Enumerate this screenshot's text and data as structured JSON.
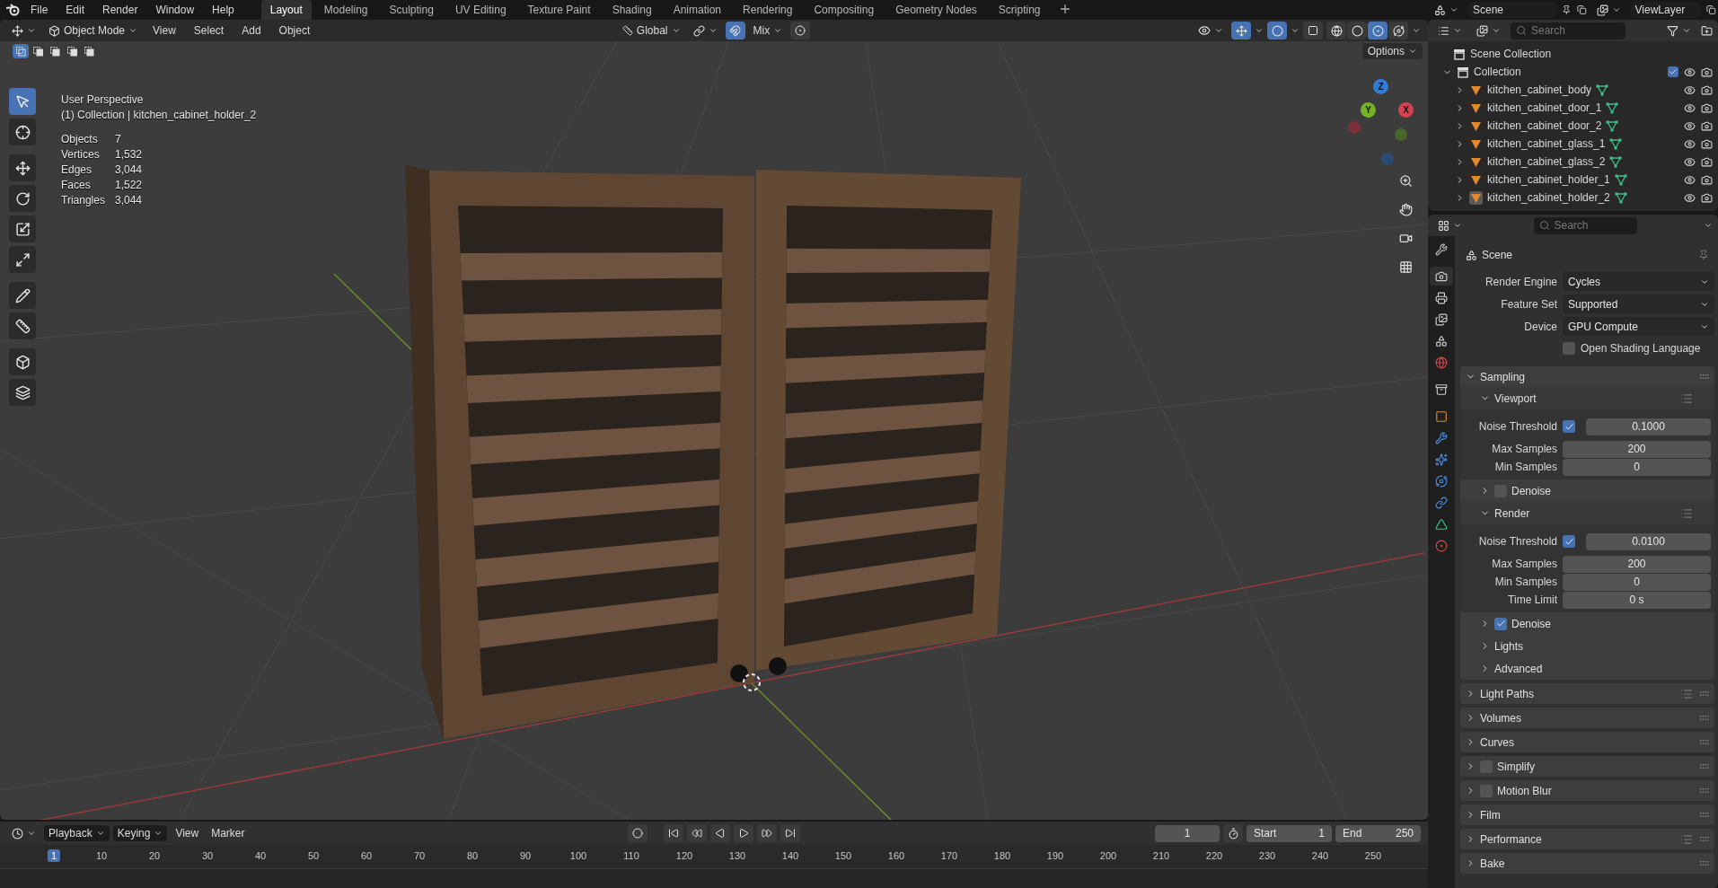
{
  "menu_bar": {
    "menus": [
      "File",
      "Edit",
      "Render",
      "Window",
      "Help"
    ]
  },
  "workspace_tabs": [
    {
      "label": "Layout",
      "selected": true
    },
    {
      "label": "Modeling",
      "selected": false
    },
    {
      "label": "Sculpting",
      "selected": false
    },
    {
      "label": "UV Editing",
      "selected": false
    },
    {
      "label": "Texture Paint",
      "selected": false
    },
    {
      "label": "Shading",
      "selected": false
    },
    {
      "label": "Animation",
      "selected": false
    },
    {
      "label": "Rendering",
      "selected": false
    },
    {
      "label": "Compositing",
      "selected": false
    },
    {
      "label": "Geometry Nodes",
      "selected": false
    },
    {
      "label": "Scripting",
      "selected": false
    }
  ],
  "scene": {
    "value": "Scene"
  },
  "view_layer": {
    "value": "ViewLayer"
  },
  "viewport": {
    "mode": "Object Mode",
    "menus": [
      "View",
      "Select",
      "Add",
      "Object"
    ],
    "orientation": "Global",
    "snap": "Mix",
    "options": "Options",
    "shading_modes": [
      {
        "selected": false
      },
      {
        "selected": false
      },
      {
        "selected": true
      },
      {
        "selected": false
      }
    ],
    "select_modes": [
      {
        "selected": true
      },
      {
        "selected": false
      },
      {
        "selected": false
      },
      {
        "selected": false
      },
      {
        "selected": false
      }
    ],
    "view_name": "User Perspective",
    "context": "(1) Collection | kitchen_cabinet_holder_2",
    "stats": [
      {
        "label": "Objects",
        "value": "7"
      },
      {
        "label": "Vertices",
        "value": "1,532"
      },
      {
        "label": "Edges",
        "value": "3,044"
      },
      {
        "label": "Faces",
        "value": "1,522"
      },
      {
        "label": "Triangles",
        "value": "3,044"
      }
    ],
    "gizmo_axes": [
      {
        "label": "Z",
        "color": "#2f7bd6"
      },
      {
        "label": "Y",
        "color": "#77b125"
      },
      {
        "label": "X",
        "color": "#d6434f"
      }
    ],
    "tools": [
      {
        "selected": true
      },
      {
        "selected": false
      },
      {
        "selected": false
      },
      {
        "selected": false
      },
      {
        "selected": false
      },
      {
        "selected": false
      },
      {
        "selected": false
      },
      {
        "selected": false
      },
      {
        "selected": false
      },
      {
        "selected": false
      }
    ]
  },
  "timeline": {
    "menus": [
      "Playback",
      "Keying",
      "View",
      "Marker"
    ],
    "current_frame": "1",
    "start_label": "Start",
    "start": "1",
    "end_label": "End",
    "end": "250",
    "ruler": [
      {
        "label": "1",
        "selected": true
      },
      {
        "label": "10",
        "selected": false
      },
      {
        "label": "20",
        "selected": false
      },
      {
        "label": "30",
        "selected": false
      },
      {
        "label": "40",
        "selected": false
      },
      {
        "label": "50",
        "selected": false
      },
      {
        "label": "60",
        "selected": false
      },
      {
        "label": "70",
        "selected": false
      },
      {
        "label": "80",
        "selected": false
      },
      {
        "label": "90",
        "selected": false
      },
      {
        "label": "100",
        "selected": false
      },
      {
        "label": "110",
        "selected": false
      },
      {
        "label": "120",
        "selected": false
      },
      {
        "label": "130",
        "selected": false
      },
      {
        "label": "140",
        "selected": false
      },
      {
        "label": "150",
        "selected": false
      },
      {
        "label": "160",
        "selected": false
      },
      {
        "label": "170",
        "selected": false
      },
      {
        "label": "180",
        "selected": false
      },
      {
        "label": "190",
        "selected": false
      },
      {
        "label": "200",
        "selected": false
      },
      {
        "label": "210",
        "selected": false
      },
      {
        "label": "220",
        "selected": false
      },
      {
        "label": "230",
        "selected": false
      },
      {
        "label": "240",
        "selected": false
      },
      {
        "label": "250",
        "selected": false
      }
    ]
  },
  "outliner": {
    "search": {
      "placeholder": "Search"
    },
    "root": "Scene Collection",
    "collection": {
      "label": "Collection",
      "checked": true,
      "expanded": true,
      "children": [
        {
          "name": "kitchen_cabinet_body",
          "active": false
        },
        {
          "name": "kitchen_cabinet_door_1",
          "active": false
        },
        {
          "name": "kitchen_cabinet_door_2",
          "active": false
        },
        {
          "name": "kitchen_cabinet_glass_1",
          "active": false
        },
        {
          "name": "kitchen_cabinet_glass_2",
          "active": false
        },
        {
          "name": "kitchen_cabinet_holder_1",
          "active": false
        },
        {
          "name": "kitchen_cabinet_holder_2",
          "active": true
        }
      ]
    }
  },
  "properties": {
    "search": {
      "placeholder": "Search"
    },
    "title": "Scene",
    "tabs": [
      {
        "selected": false
      },
      {
        "selected": true
      },
      {
        "selected": false
      },
      {
        "selected": false
      },
      {
        "selected": false
      },
      {
        "selected": false
      },
      {
        "selected": false
      },
      {
        "selected": false
      },
      {
        "selected": false
      },
      {
        "selected": false
      },
      {
        "selected": false
      },
      {
        "selected": false
      },
      {
        "selected": false
      },
      {
        "selected": false
      }
    ],
    "fields": [
      {
        "label": "Render Engine",
        "value": "Cycles"
      },
      {
        "label": "Feature Set",
        "value": "Supported"
      },
      {
        "label": "Device",
        "value": "GPU Compute"
      }
    ],
    "osl": {
      "label": "Open Shading Language",
      "checked": false
    },
    "panels": [
      {
        "title": "Sampling",
        "expanded": true,
        "subpanels": [
          {
            "title": "Viewport",
            "expanded": true,
            "presets": true,
            "rows": [
              {
                "kind": "threshold",
                "label": "Noise Threshold",
                "checked": true,
                "value": "0.1000"
              },
              {
                "kind": "number",
                "label": "Max Samples",
                "value": "200"
              },
              {
                "kind": "number",
                "label": "Min Samples",
                "value": "0"
              }
            ]
          },
          {
            "title": "Denoise",
            "expanded": false,
            "checked": false
          },
          {
            "title": "Render",
            "expanded": true,
            "presets": true,
            "rows": [
              {
                "kind": "threshold",
                "label": "Noise Threshold",
                "checked": true,
                "value": "0.0100"
              },
              {
                "kind": "number",
                "label": "Max Samples",
                "value": "200"
              },
              {
                "kind": "number",
                "label": "Min Samples",
                "value": "0"
              },
              {
                "kind": "number",
                "label": "Time Limit",
                "value": "0 s"
              }
            ]
          },
          {
            "title": "Denoise",
            "expanded": false,
            "checked": true
          },
          {
            "title": "Lights",
            "expanded": false
          },
          {
            "title": "Advanced",
            "expanded": false
          }
        ]
      },
      {
        "title": "Light Paths",
        "expanded": false,
        "presets": true
      },
      {
        "title": "Volumes",
        "expanded": false
      },
      {
        "title": "Curves",
        "expanded": false
      },
      {
        "title": "Simplify",
        "expanded": false,
        "checked": false
      },
      {
        "title": "Motion Blur",
        "expanded": false,
        "checked": false
      },
      {
        "title": "Film",
        "expanded": false
      },
      {
        "title": "Performance",
        "expanded": false,
        "presets": true
      },
      {
        "title": "Bake",
        "expanded": false
      }
    ]
  }
}
